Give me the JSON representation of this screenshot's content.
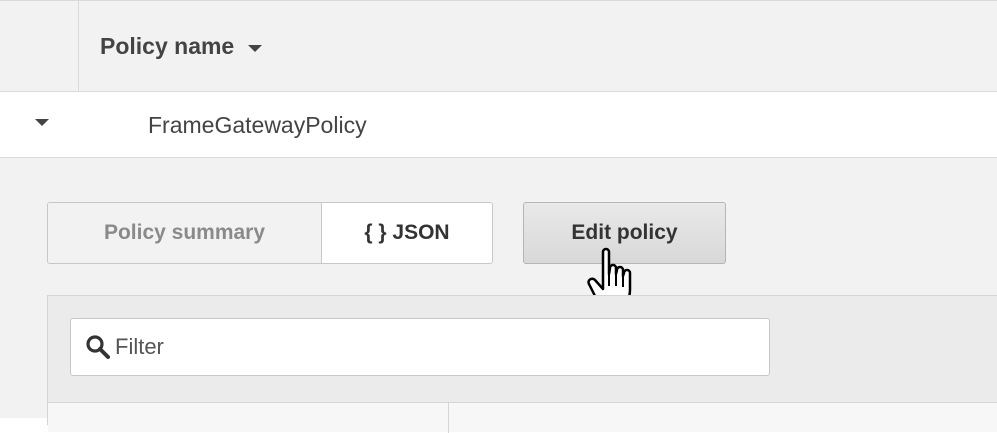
{
  "table": {
    "column_header": "Policy name"
  },
  "policy_row": {
    "name": "FrameGatewayPolicy"
  },
  "tabs": [
    {
      "label": "Policy summary"
    },
    {
      "label": "{ } JSON"
    }
  ],
  "actions": {
    "edit_label": "Edit policy"
  },
  "filter": {
    "placeholder": "Filter"
  },
  "icons": {
    "sort": "chevron-down-icon",
    "expand": "expand-caret-icon",
    "search": "search-icon",
    "cursor": "hand-pointer-icon"
  },
  "colors": {
    "header_bg": "#f2f2f2",
    "panel_bg": "#f2f2f2",
    "border": "#dadada",
    "text": "#444444",
    "muted_text": "#8a8a8a"
  }
}
